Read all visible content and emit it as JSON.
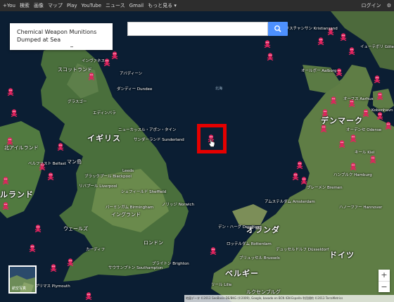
{
  "topbar": {
    "left_items": [
      "+You",
      "検索",
      "画像",
      "マップ",
      "Play",
      "YouTube",
      "ニュース",
      "Gmail",
      "もっと見る ▾"
    ],
    "login": "ログイン"
  },
  "infobox": {
    "title": "Chemical Weapon Munitions Dumped at Sea"
  },
  "search": {
    "placeholder": "",
    "value": ""
  },
  "map_labels": {
    "scotland": "スコットランド",
    "britain": "イギリス",
    "n_ireland": "北アイルランド",
    "ireland": "ルランド",
    "wales": "ウェールズ",
    "england": "イングランド",
    "denmark": "デンマーク",
    "netherlands": "オランダ",
    "belgium": "ベルギー",
    "germany": "ドイツ",
    "luxembourg": "ルクセンブルグ",
    "isle_of_man": "マン島",
    "glasgow": "グラスゴー",
    "edinburgh": "エディンバラ",
    "newcastle": "ニューカッスル・アポン・タイン",
    "sunderland": "サンダーランド Sunderland",
    "leeds": "Leeds",
    "sheffield": "シェフィールド Sheffield",
    "liverpool": "リバプール Liverpool",
    "birmingham": "バーミンガム Birmingham",
    "norwich": "ノリッジ Norwich",
    "london": "ロンドン",
    "southampton": "サウサンプトン Southampton",
    "brighton": "ブライトン Brighton",
    "cardiff": "カーディフ",
    "plymouth": "プリマス Plymouth",
    "amsterdam": "アムステルダム Amsterdam",
    "hague": "デン・ハーグ Den Haag",
    "rotterdam": "ロッテルダム Rotterdam",
    "brussels": "ブリュッセル Brussels",
    "bremen": "ブレーメン Bremen",
    "hamburg": "ハンブルク Hamburg",
    "hannover": "ハノーファー Hannover",
    "dusseldorf": "デュッセルドルフ Düsseldorf",
    "kobenhavn": "Kobenhavn",
    "aarhus": "オーフス Aarhus",
    "goteborg": "イェーテボリ Göteborg",
    "kristiansand": "クリスチャンサン Kristiansand",
    "north_sea": "北海",
    "dundee": "ダンディー Dundee",
    "aberdeen": "アバディーン",
    "inverness": "インヴァネス",
    "belfast": "ベルファスト Belfast",
    "blackpool": "ブラックプール Blackpool",
    "kiel": "キール Kiel",
    "lille": "リール Lille",
    "aalborg": "オールボー Aalborg",
    "odense": "オーデンセ Odense"
  },
  "attribution": "地図データ ©2013 GeoBasis-DE/BKG (©2009), Google, basado en BCN IGN España 利用規約 ©2013 TerraMetrics",
  "zoom": {
    "in": "+",
    "out": "−"
  },
  "thumbnail": {
    "caption": "航空写真"
  },
  "colors": {
    "water": "#0b1e33",
    "marker": "#e0245e",
    "highlight": "#e50000",
    "search_button": "#4d90fe"
  },
  "markers_count": 48
}
